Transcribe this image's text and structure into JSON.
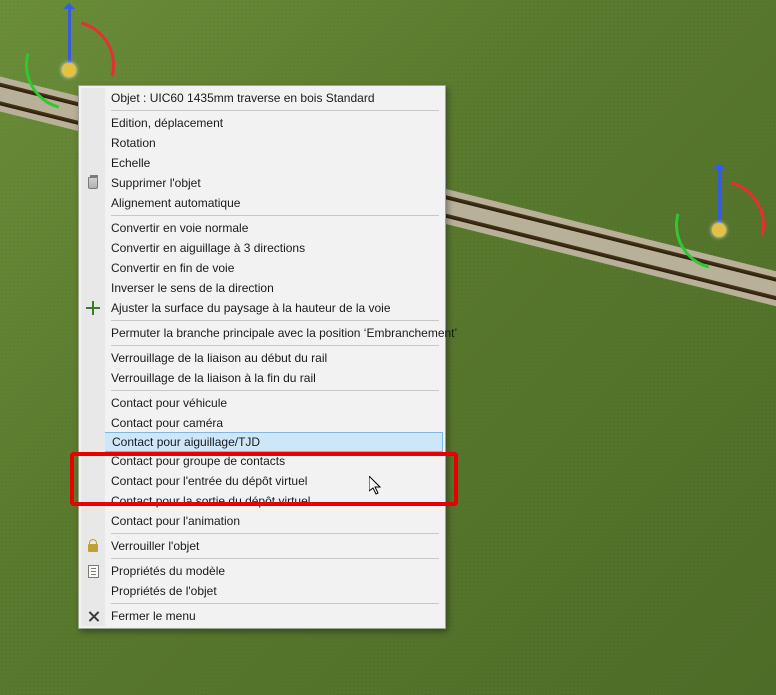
{
  "object_label_prefix": "Objet :",
  "object_name": "UIC60 1435mm traverse en bois Standard",
  "menu": {
    "edit_move": "Edition, déplacement",
    "rotation": "Rotation",
    "scale": "Echelle",
    "delete": "Supprimer l'objet",
    "auto_align": "Alignement automatique",
    "to_normal_track": "Convertir en voie normale",
    "to_3way_switch": "Convertir en aiguillage à 3 directions",
    "to_end_track": "Convertir en fin de voie",
    "invert_direction": "Inverser le sens de la direction",
    "adjust_surface": "Ajuster la surface du paysage à la hauteur de la voie",
    "swap_main_branch": "Permuter la branche principale avec la position ‘Embranchement’",
    "lock_start": "Verrouillage de la liaison au début du rail",
    "lock_end": "Verrouillage de la liaison à la fin du rail",
    "contact_vehicle": "Contact pour véhicule",
    "contact_camera": "Contact pour caméra",
    "contact_group": "Contact pour groupe de contacts",
    "contact_switch": "Contact pour aiguillage/TJD",
    "contact_depot_in": "Contact pour l'entrée du dépôt virtuel",
    "contact_depot_out": "Contact pour la sortie du dépôt virtuel",
    "contact_anim": "Contact pour l'animation",
    "lock_object": "Verrouiller l'objet",
    "model_props": "Propriétés du modèle",
    "object_props": "Propriétés de l'objet",
    "close": "Fermer le menu"
  }
}
